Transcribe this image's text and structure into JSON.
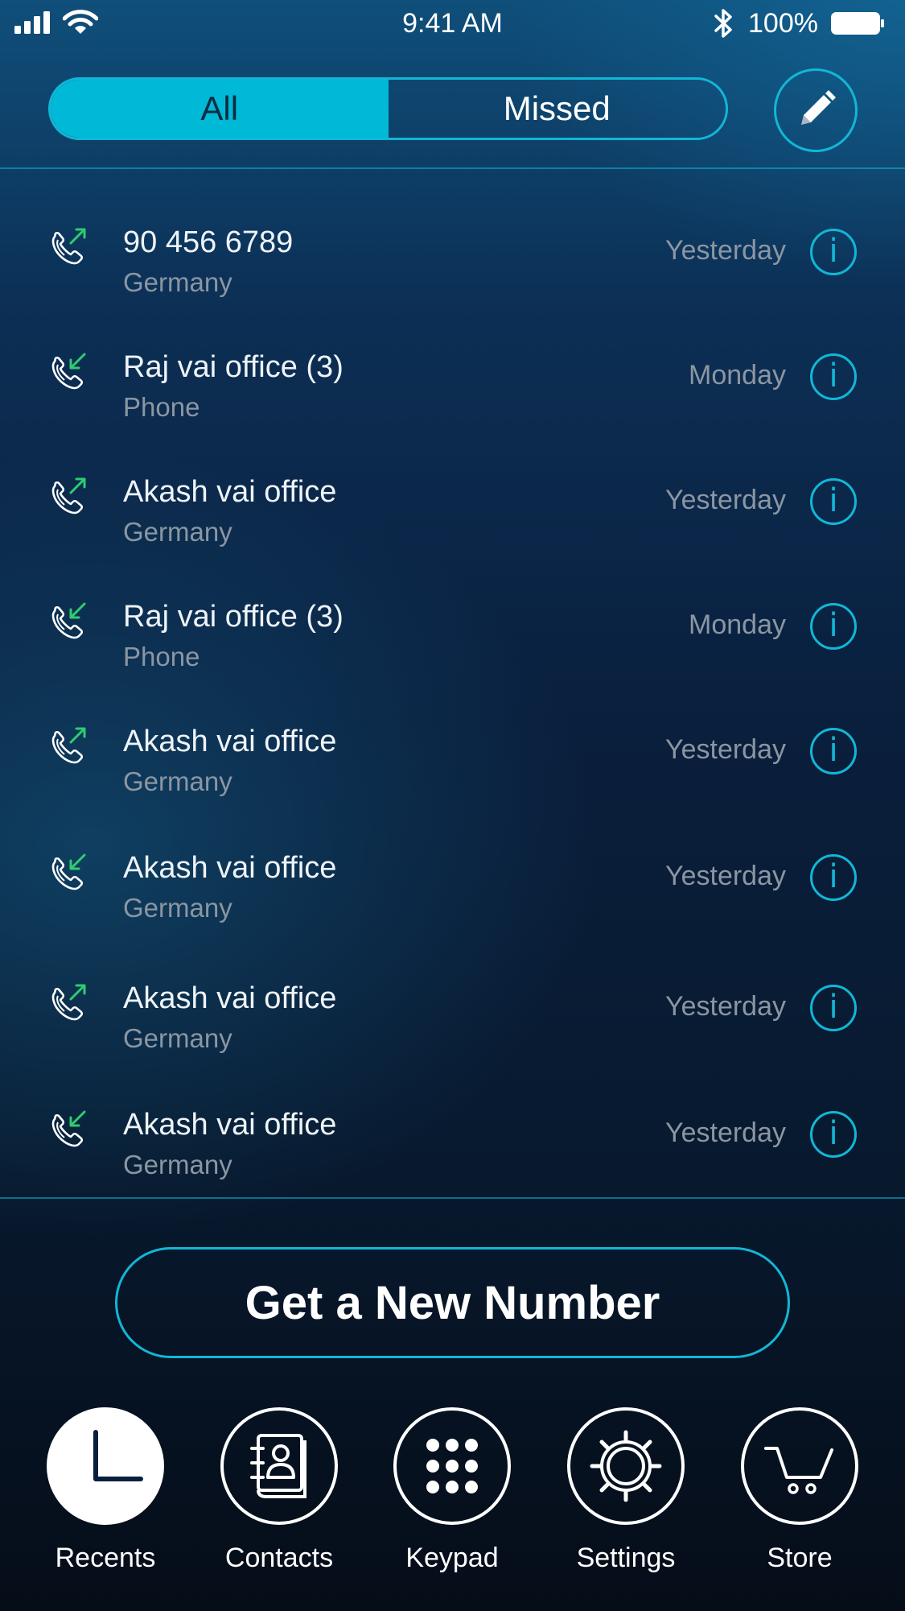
{
  "status_bar": {
    "time": "9:41 AM",
    "battery": "100%",
    "icons": [
      "signal-icon",
      "wifi-icon",
      "bluetooth-icon",
      "battery-icon"
    ]
  },
  "filter_tabs": {
    "all_label": "All",
    "missed_label": "Missed",
    "selected": "All"
  },
  "colors": {
    "accent": "#00b9d6",
    "outgoing_arrow": "#2ecc71",
    "incoming_arrow": "#2ecc71",
    "secondary_text": "#8a96a3"
  },
  "calls": [
    {
      "name": "90 456 6789",
      "sub": "Germany",
      "time": "Yesterday",
      "direction": "outgoing",
      "info": "i"
    },
    {
      "name": "Raj vai office (3)",
      "sub": "Phone",
      "time": "Monday",
      "direction": "incoming",
      "info": "i"
    },
    {
      "name": "Akash vai office",
      "sub": "Germany",
      "time": "Yesterday",
      "direction": "outgoing",
      "info": "i"
    },
    {
      "name": "Raj vai office (3)",
      "sub": "Phone",
      "time": "Monday",
      "direction": "incoming",
      "info": "i"
    },
    {
      "name": "Akash vai office",
      "sub": "Germany",
      "time": "Yesterday",
      "direction": "outgoing",
      "info": "i"
    },
    {
      "name": "Akash vai office",
      "sub": "Germany",
      "time": "Yesterday",
      "direction": "incoming",
      "info": "i"
    },
    {
      "name": "Akash vai office",
      "sub": "Germany",
      "time": "Yesterday",
      "direction": "outgoing",
      "info": "i"
    },
    {
      "name": "Akash vai office",
      "sub": "Germany",
      "time": "Yesterday",
      "direction": "incoming",
      "info": "i"
    }
  ],
  "cta": {
    "label": "Get a New Number"
  },
  "tab_bar": {
    "active": "Recents",
    "items": [
      {
        "label": "Recents",
        "icon": "clock-icon"
      },
      {
        "label": "Contacts",
        "icon": "contacts-book-icon"
      },
      {
        "label": "Keypad",
        "icon": "keypad-icon"
      },
      {
        "label": "Settings",
        "icon": "gear-icon"
      },
      {
        "label": "Store",
        "icon": "cart-icon"
      }
    ]
  }
}
